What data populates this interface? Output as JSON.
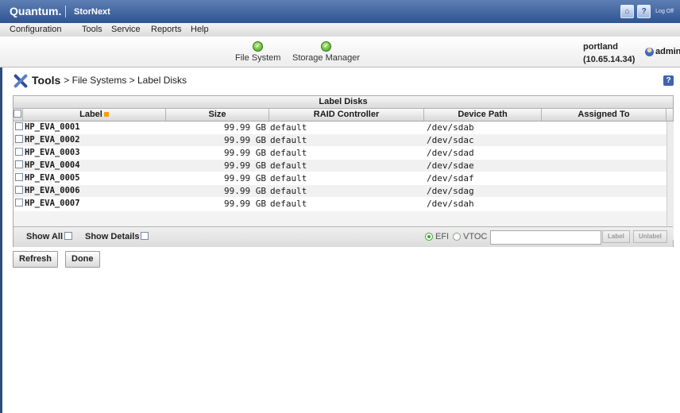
{
  "topbar": {
    "brand": "Quantum.",
    "product": "StorNext",
    "home_icon": "home-icon",
    "help_icon": "help-icon",
    "logoff_label": "Log Off"
  },
  "menu": [
    "Configuration",
    "Tools",
    "Service",
    "Reports",
    "Help"
  ],
  "services": [
    {
      "label": "File System",
      "status": "ok",
      "icon": "check-circle-icon"
    },
    {
      "label": "Storage Manager",
      "status": "ok",
      "icon": "check-circle-icon"
    }
  ],
  "host": {
    "name": "portland",
    "ip": "(10.65.14.34)"
  },
  "user": {
    "name": "admin",
    "icon": "user-icon"
  },
  "breadcrumb": {
    "main": "Tools",
    "rest": "> File Systems > Label Disks"
  },
  "panel": {
    "title": "Label Disks",
    "columns": [
      "Label",
      "Size",
      "RAID Controller",
      "Device Path",
      "Assigned To"
    ],
    "rows": [
      {
        "label": "HP_EVA_0001",
        "size": "99.99 GB",
        "raid": "default",
        "path": "/dev/sdab",
        "assigned": ""
      },
      {
        "label": "HP_EVA_0002",
        "size": "99.99 GB",
        "raid": "default",
        "path": "/dev/sdac",
        "assigned": ""
      },
      {
        "label": "HP_EVA_0003",
        "size": "99.99 GB",
        "raid": "default",
        "path": "/dev/sdad",
        "assigned": ""
      },
      {
        "label": "HP_EVA_0004",
        "size": "99.99 GB",
        "raid": "default",
        "path": "/dev/sdae",
        "assigned": ""
      },
      {
        "label": "HP_EVA_0005",
        "size": "99.99 GB",
        "raid": "default",
        "path": "/dev/sdaf",
        "assigned": ""
      },
      {
        "label": "HP_EVA_0006",
        "size": "99.99 GB",
        "raid": "default",
        "path": "/dev/sdag",
        "assigned": ""
      },
      {
        "label": "HP_EVA_0007",
        "size": "99.99 GB",
        "raid": "default",
        "path": "/dev/sdah",
        "assigned": ""
      }
    ],
    "show_all": "Show All",
    "show_details": "Show Details",
    "efi": "EFI",
    "vtoc": "VTOC",
    "selected_format": "EFI",
    "label_input_value": "",
    "label_button": "Label",
    "unlabel_button": "Unlabel"
  },
  "buttons": {
    "refresh": "Refresh",
    "done": "Done"
  },
  "colors": {
    "header": "#2e5492",
    "status_ok": "#3f9b1b",
    "sort_indicator": "#f0a000"
  }
}
